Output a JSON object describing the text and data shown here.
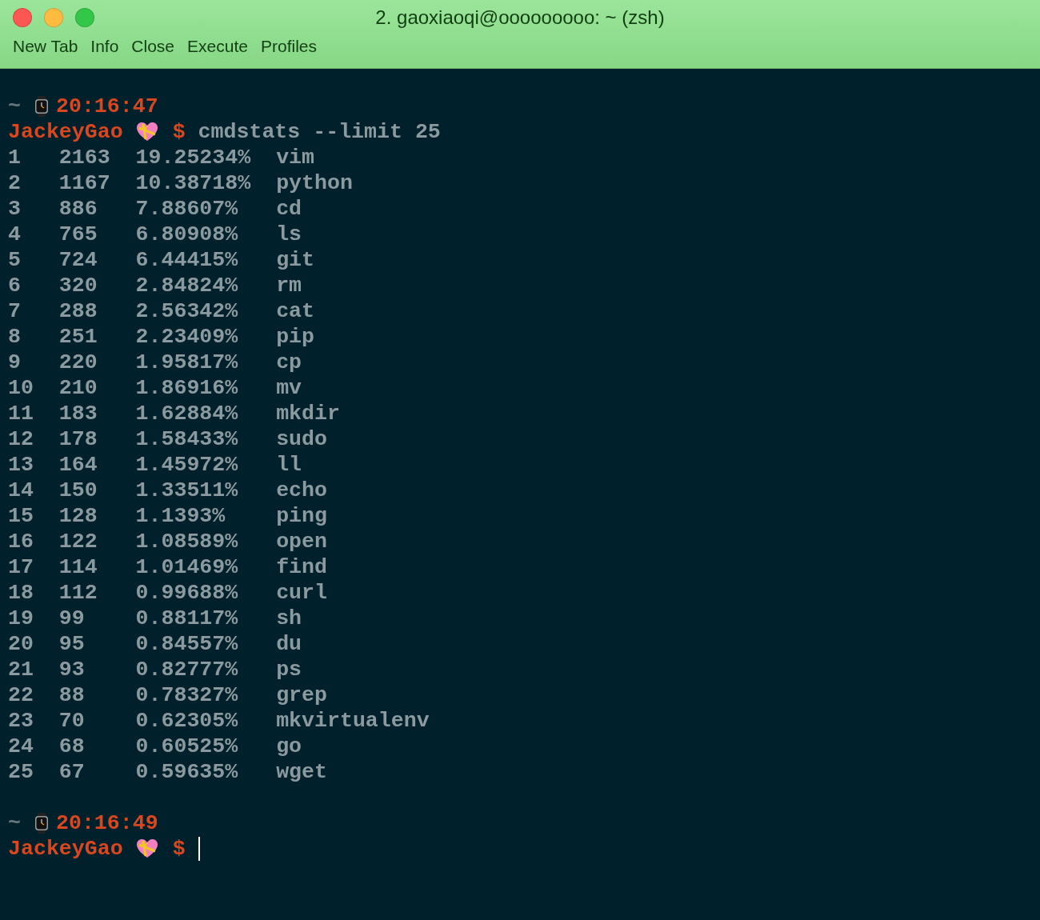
{
  "window": {
    "title": "2. gaoxiaoqi@ooooooooo: ~ (zsh)"
  },
  "toolbar": [
    "New Tab",
    "Info",
    "Close",
    "Execute",
    "Profiles"
  ],
  "blocks": [
    {
      "path": "~",
      "time": "20:16:47",
      "user": "JackeyGao",
      "symbol": "$",
      "command": "cmdstats --limit 25",
      "output": [
        [
          "1",
          "2163",
          "19.25234%",
          "vim"
        ],
        [
          "2",
          "1167",
          "10.38718%",
          "python"
        ],
        [
          "3",
          "886",
          "7.88607%",
          "cd"
        ],
        [
          "4",
          "765",
          "6.80908%",
          "ls"
        ],
        [
          "5",
          "724",
          "6.44415%",
          "git"
        ],
        [
          "6",
          "320",
          "2.84824%",
          "rm"
        ],
        [
          "7",
          "288",
          "2.56342%",
          "cat"
        ],
        [
          "8",
          "251",
          "2.23409%",
          "pip"
        ],
        [
          "9",
          "220",
          "1.95817%",
          "cp"
        ],
        [
          "10",
          "210",
          "1.86916%",
          "mv"
        ],
        [
          "11",
          "183",
          "1.62884%",
          "mkdir"
        ],
        [
          "12",
          "178",
          "1.58433%",
          "sudo"
        ],
        [
          "13",
          "164",
          "1.45972%",
          "ll"
        ],
        [
          "14",
          "150",
          "1.33511%",
          "echo"
        ],
        [
          "15",
          "128",
          "1.1393%",
          "ping"
        ],
        [
          "16",
          "122",
          "1.08589%",
          "open"
        ],
        [
          "17",
          "114",
          "1.01469%",
          "find"
        ],
        [
          "18",
          "112",
          "0.99688%",
          "curl"
        ],
        [
          "19",
          "99",
          "0.88117%",
          "sh"
        ],
        [
          "20",
          "95",
          "0.84557%",
          "du"
        ],
        [
          "21",
          "93",
          "0.82777%",
          "ps"
        ],
        [
          "22",
          "88",
          "0.78327%",
          "grep"
        ],
        [
          "23",
          "70",
          "0.62305%",
          "mkvirtualenv"
        ],
        [
          "24",
          "68",
          "0.60525%",
          "go"
        ],
        [
          "25",
          "67",
          "0.59635%",
          "wget"
        ]
      ]
    },
    {
      "path": "~",
      "time": "20:16:49",
      "user": "JackeyGao",
      "symbol": "$",
      "cursor": true
    }
  ]
}
